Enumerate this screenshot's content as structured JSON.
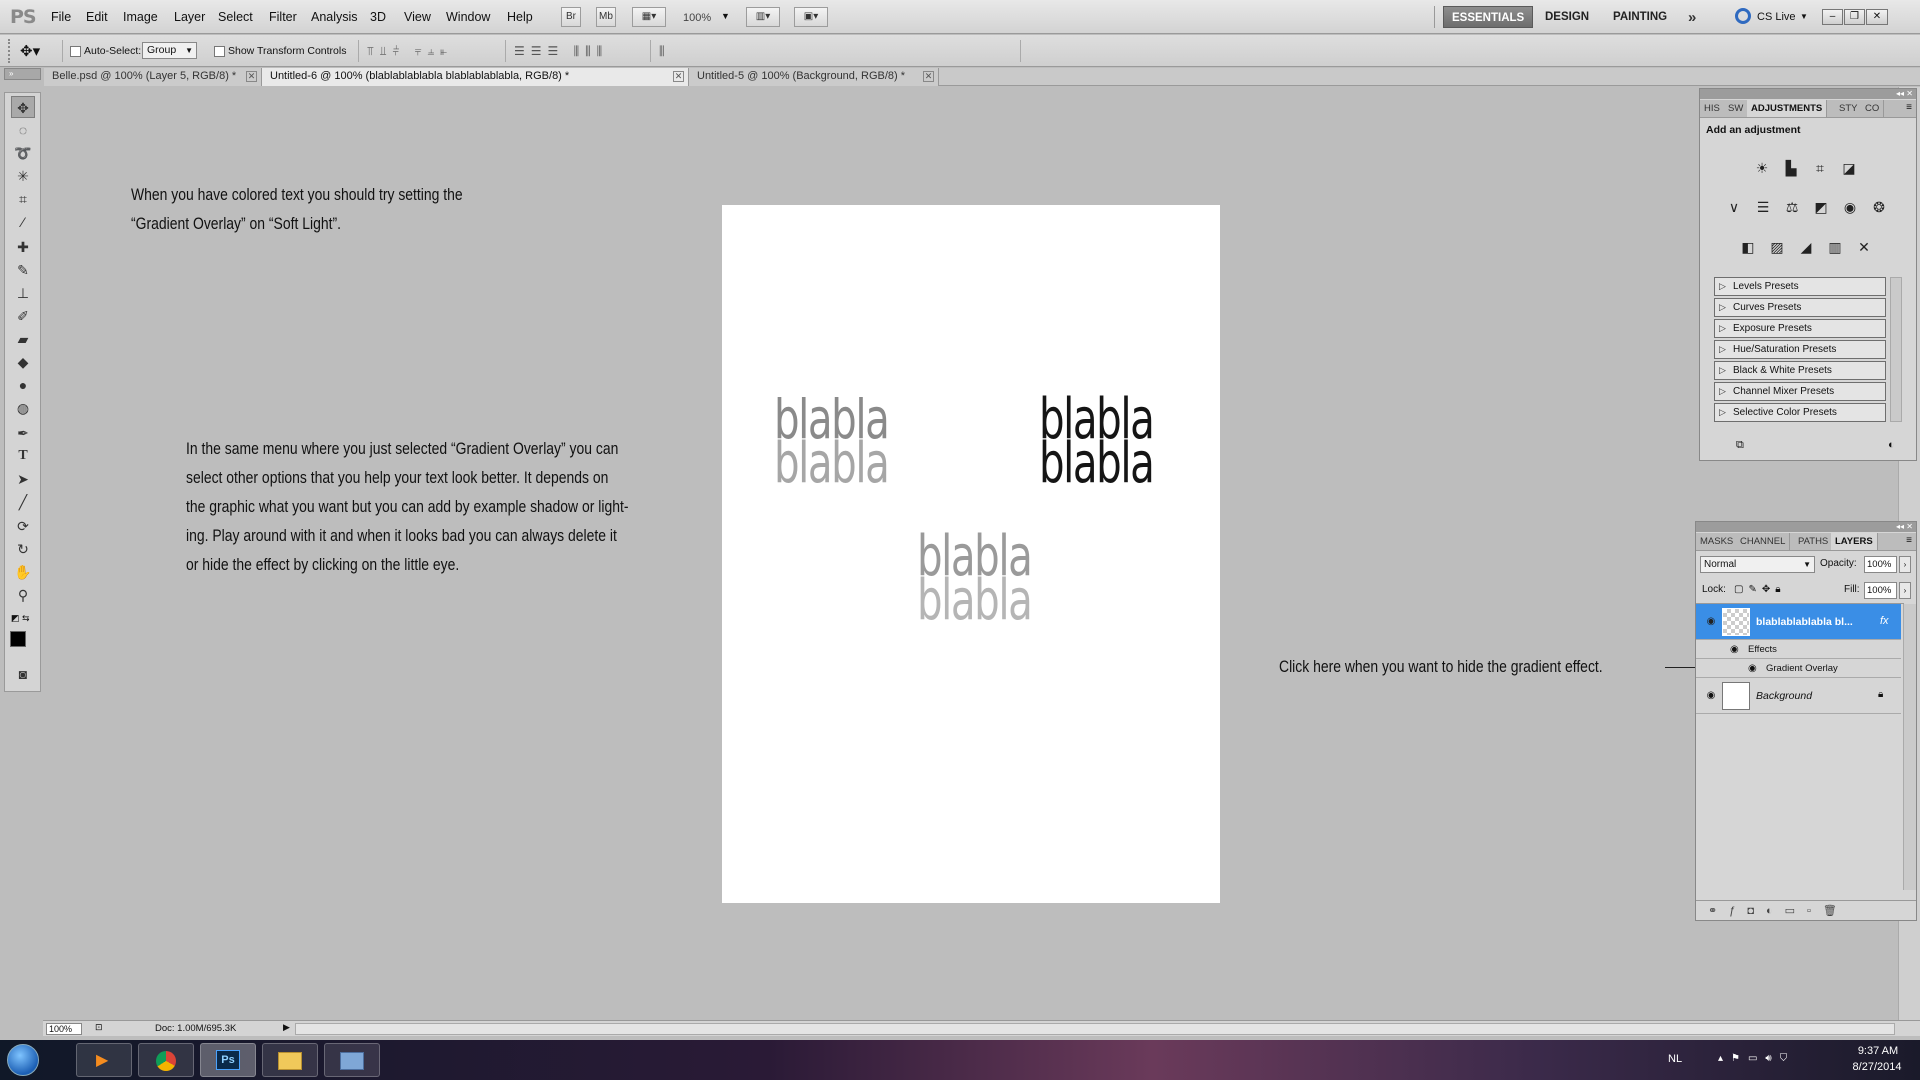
{
  "menubar": {
    "logo": "PS",
    "items": [
      "File",
      "Edit",
      "Image",
      "Layer",
      "Select",
      "Filter",
      "Analysis",
      "3D",
      "View",
      "Window",
      "Help"
    ],
    "quick_buttons": [
      "Br",
      "Mb"
    ],
    "zoom": "100%",
    "workspaces": [
      "ESSENTIALS",
      "DESIGN",
      "PAINTING"
    ],
    "cs_live": "CS Live"
  },
  "options": {
    "auto_select_label": "Auto-Select:",
    "auto_select_value": "Group",
    "transform_label": "Show Transform Controls"
  },
  "tabs": [
    {
      "label": "Belle.psd @ 100% (Layer 5, RGB/8) *"
    },
    {
      "label": "Untitled-6 @ 100% (blablablablabla blablablablabla, RGB/8) *"
    },
    {
      "label": "Untitled-5 @ 100% (Background, RGB/8) *"
    }
  ],
  "canvas": {
    "note1": [
      "When you have colored text you should try setting the",
      "“Gradient Overlay” on “Soft Light”."
    ],
    "note2": [
      "In the same menu where you just selected “Gradient Overlay” you can",
      "select other options that you help your text look better. It depends on",
      "the graphic what you want but you can add by example shadow or light-",
      "ing. Play around with it and when it looks bad you can always delete it",
      "or hide the effect by clicking on the little eye."
    ],
    "note3": "Click here when you want to hide the gradient effect.",
    "sample_word": "blabla"
  },
  "adjustments": {
    "tabs": [
      "HIS",
      "SW",
      "ADJUSTMENTS",
      "STY",
      "CO"
    ],
    "heading": "Add an adjustment",
    "presets": [
      "Levels Presets",
      "Curves Presets",
      "Exposure Presets",
      "Hue/Saturation Presets",
      "Black & White Presets",
      "Channel Mixer Presets",
      "Selective Color Presets"
    ]
  },
  "layers": {
    "tabs": [
      "MASKS",
      "CHANNEL",
      "PATHS",
      "LAYERS"
    ],
    "blend_mode": "Normal",
    "opacity_label": "Opacity:",
    "opacity": "100%",
    "lock_label": "Lock:",
    "fill_label": "Fill:",
    "fill": "100%",
    "layer1": "blablablablabla bl...",
    "effects": "Effects",
    "gradient_overlay": "Gradient Overlay",
    "background": "Background",
    "fx": "fx"
  },
  "status": {
    "zoom": "100%",
    "doc": "Doc: 1.00M/695.3K"
  },
  "taskbar": {
    "lang": "NL",
    "time": "9:37 AM",
    "date": "8/27/2014",
    "ps_label": "Ps"
  }
}
